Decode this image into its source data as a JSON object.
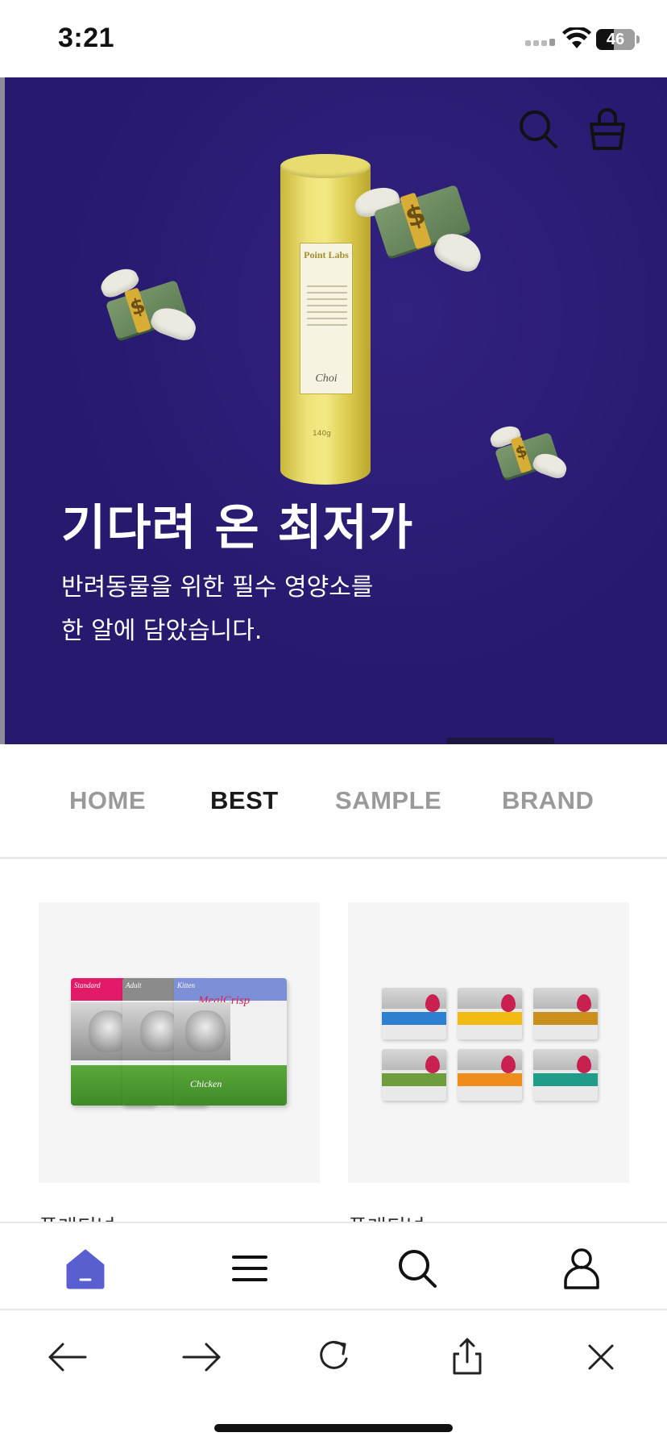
{
  "status_bar": {
    "time": "3:21",
    "battery_level": "46",
    "battery_fraction": 0.46
  },
  "hero": {
    "title": "기다려 온 최저가",
    "subtitle_line1": "반려동물을 위한 필수 영양소를",
    "subtitle_line2": "한 알에 담았습니다.",
    "background_color": "#27196e",
    "product_brand": "Point Labs",
    "product_weight": "140g",
    "icons": [
      "search-icon",
      "shopping-bag-icon"
    ]
  },
  "tabs": [
    {
      "label": "HOME",
      "active": false
    },
    {
      "label": "BEST",
      "active": true
    },
    {
      "label": "SAMPLE",
      "active": false
    },
    {
      "label": "BRAND",
      "active": false
    }
  ],
  "products": [
    {
      "image": "cat-food-bags",
      "bags": [
        "Standard",
        "Adult",
        "Kitten"
      ],
      "bag_title": "MealCrisp",
      "bag_flavor": "Chicken",
      "caption": "플래티넘"
    },
    {
      "image": "wet-food-cartons",
      "caption": "플래티넘"
    }
  ],
  "bottom_nav": {
    "items": [
      "home-icon",
      "menu-icon",
      "search-icon",
      "account-icon"
    ],
    "accent": "#5a5fd0"
  },
  "browser_toolbar": {
    "items": [
      "back-arrow-icon",
      "forward-arrow-icon",
      "reload-icon",
      "share-icon",
      "close-icon"
    ]
  }
}
